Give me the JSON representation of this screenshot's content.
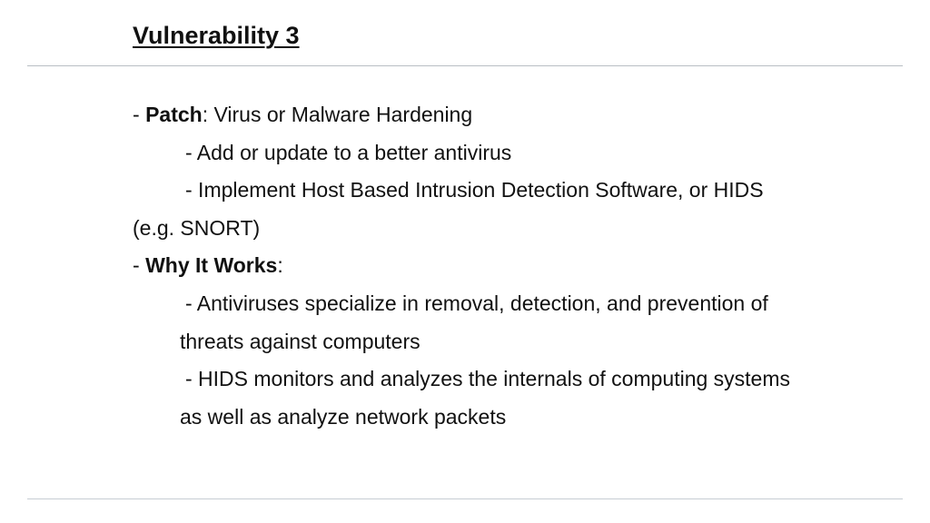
{
  "slide": {
    "title": "Vulnerability 3",
    "patch": {
      "prefix": "- ",
      "label": "Patch",
      "text": ": Virus or Malware Hardening",
      "sub1": "- Add or update to a better antivirus",
      "sub2": "- Implement Host Based Intrusion Detection Software, or HIDS",
      "sub2_cont": "(e.g. SNORT)"
    },
    "why": {
      "prefix": "- ",
      "label": "Why It Works",
      "text": ":",
      "sub1": "- Antiviruses specialize in removal, detection, and prevention of",
      "sub1_cont": "threats against computers",
      "sub2": "- HIDS monitors and analyzes the internals of computing systems",
      "sub2_cont": "as well as analyze network packets"
    }
  }
}
